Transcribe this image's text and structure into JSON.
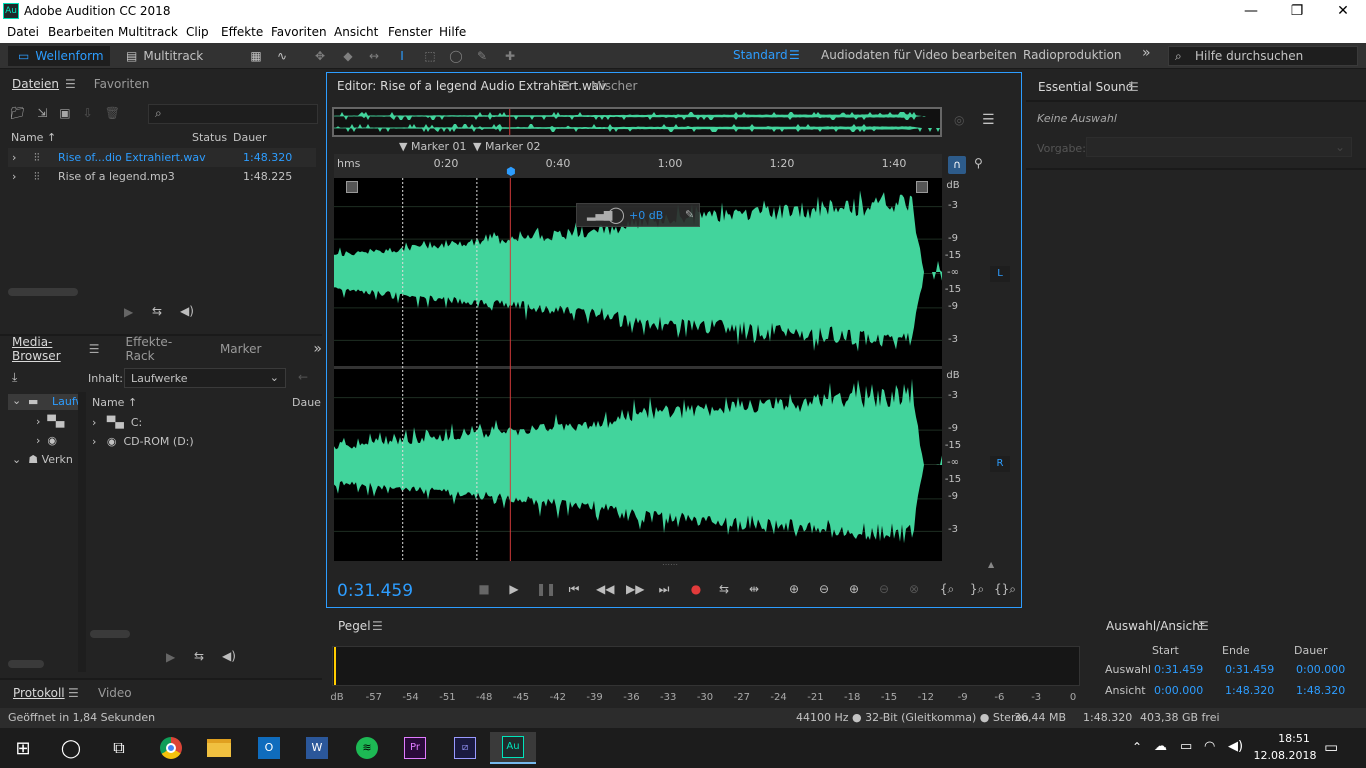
{
  "window": {
    "title": "Adobe Audition CC 2018",
    "icon_label": "Au"
  },
  "menu": [
    "Datei",
    "Bearbeiten",
    "Multitrack",
    "Clip",
    "Effekte",
    "Favoriten",
    "Ansicht",
    "Fenster",
    "Hilfe"
  ],
  "toolbar": {
    "waveform_label": "Wellenform",
    "multitrack_label": "Multitrack",
    "workspaces": [
      "Standard",
      "Audiodaten für Video bearbeiten",
      "Radioproduktion"
    ],
    "more": "»",
    "help_placeholder": "Hilfe durchsuchen"
  },
  "files_panel": {
    "tabs": [
      "Dateien",
      "Favoriten"
    ],
    "columns": {
      "name": "Name ↑",
      "status": "Status",
      "duration": "Dauer"
    },
    "rows": [
      {
        "name": "Rise of...dio Extrahiert.wav",
        "duration": "1:48.320",
        "selected": true
      },
      {
        "name": "Rise of a legend.mp3",
        "duration": "1:48.225",
        "selected": false
      }
    ]
  },
  "media_panel": {
    "tabs": [
      "Media-Browser",
      "Effekte-Rack",
      "Marker"
    ],
    "content_label": "Inhalt:",
    "content_value": "Laufwerke",
    "tree": [
      "Laufw",
      "Verkn"
    ],
    "columns": {
      "name": "Name ↑",
      "duration": "Daue"
    },
    "drives": [
      "C:",
      "CD-ROM (D:)"
    ]
  },
  "bottom_left_tabs": [
    "Protokoll",
    "Video"
  ],
  "editor": {
    "tab_title": "Editor: Rise of a legend Audio Extrahiert.wav",
    "mixer_tab": "Mischer",
    "markers": [
      "Marker 01",
      "Marker 02"
    ],
    "ruler_unit": "hms",
    "ruler_ticks": [
      "0:20",
      "0:40",
      "1:00",
      "1:20",
      "1:40"
    ],
    "db_scale_top": [
      "dB",
      "-3",
      "-9",
      "-15",
      "-∞",
      "-15",
      "-9",
      "-3"
    ],
    "db_scale_bottom": [
      "dB",
      "-3",
      "-9",
      "-15",
      "-∞",
      "-15",
      "-9",
      "-3"
    ],
    "channel_left": "L",
    "channel_right": "R",
    "hud_gain": "+0 dB",
    "time_display": "0:31.459",
    "playhead_fraction": 0.29
  },
  "essential_sound": {
    "title": "Essential Sound",
    "no_selection": "Keine Auswahl",
    "preset_label": "Vorgabe:"
  },
  "level_panel": {
    "title": "Pegel",
    "scale": [
      "dB",
      "-57",
      "-54",
      "-51",
      "-48",
      "-45",
      "-42",
      "-39",
      "-36",
      "-33",
      "-30",
      "-27",
      "-24",
      "-21",
      "-18",
      "-15",
      "-12",
      "-9",
      "-6",
      "-3",
      "0"
    ]
  },
  "selection_view": {
    "title": "Auswahl/Ansicht",
    "headers": [
      "Start",
      "Ende",
      "Dauer"
    ],
    "rows": [
      {
        "label": "Auswahl",
        "values": [
          "0:31.459",
          "0:31.459",
          "0:00.000"
        ]
      },
      {
        "label": "Ansicht",
        "values": [
          "0:00.000",
          "1:48.320",
          "1:48.320"
        ]
      }
    ]
  },
  "status_bar": {
    "left": "Geöffnet in 1,84 Sekunden",
    "format": "44100 Hz ● 32-Bit (Gleitkomma) ● Stereo",
    "size": "36,44 MB",
    "duration": "1:48.320",
    "free": "403,38 GB frei"
  },
  "taskbar": {
    "time": "18:51",
    "date": "12.08.2018"
  },
  "colors": {
    "accent": "#2d9dff",
    "waveform": "#42d49c",
    "playhead": "#d23a3a",
    "record": "#e23b3b"
  }
}
